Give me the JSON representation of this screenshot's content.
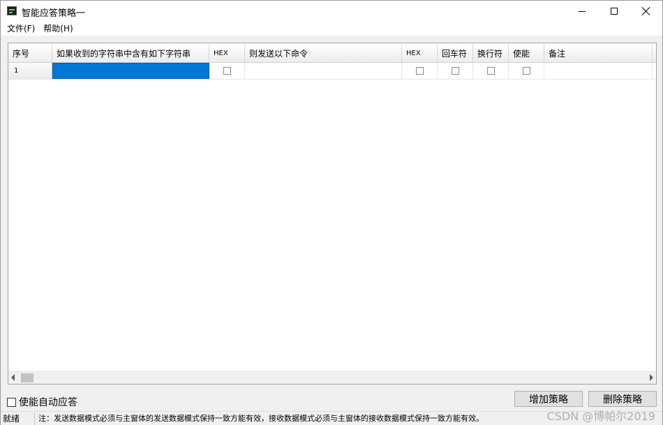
{
  "window": {
    "title": "智能应答策略一"
  },
  "menu": {
    "items": [
      {
        "label": "文件(F)"
      },
      {
        "label": "帮助(H)"
      }
    ]
  },
  "table": {
    "headers": {
      "index": "序号",
      "match": "如果收到的字符串中含有如下字符串",
      "hex1": "HEX",
      "send": "则发送以下命令",
      "hex2": "HEX",
      "cr": "回车符",
      "lf": "换行符",
      "enable": "使能",
      "note": "备注"
    },
    "rows": [
      {
        "index": "1",
        "match": "",
        "send": "",
        "note": ""
      }
    ]
  },
  "options": {
    "auto_reply_label": "使能自动应答"
  },
  "buttons": {
    "add": "增加策略",
    "delete": "删除策略"
  },
  "status": {
    "ready": "就绪",
    "note": "注：发送数据模式必须与主窗体的发送数据模式保持一致方能有效，接收数据模式必须与主窗体的接收数据模式保持一致方能有效。"
  },
  "watermark": "CSDN @博帕尔2019"
}
